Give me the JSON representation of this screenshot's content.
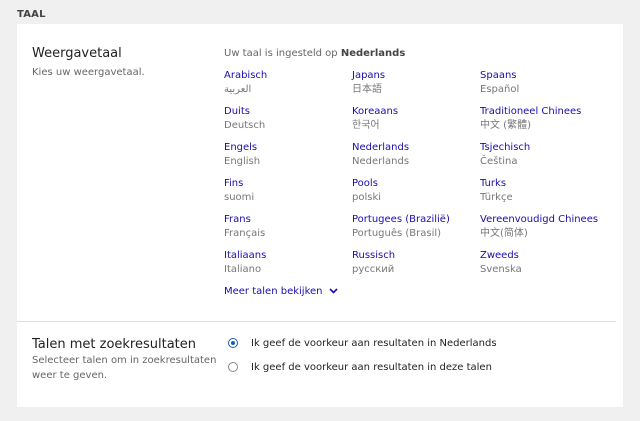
{
  "section_title": "TAAL",
  "display_language": {
    "heading": "Weergavetaal",
    "description": "Kies uw weergavetaal.",
    "current_prefix": "Uw taal is ingesteld op",
    "current_value": "Nederlands",
    "languages": [
      {
        "name": "Arabisch",
        "native": "العربية"
      },
      {
        "name": "Japans",
        "native": "日本語"
      },
      {
        "name": "Spaans",
        "native": "Español"
      },
      {
        "name": "Duits",
        "native": "Deutsch"
      },
      {
        "name": "Koreaans",
        "native": "한국어"
      },
      {
        "name": "Traditioneel Chinees",
        "native": "中文 (繁體)"
      },
      {
        "name": "Engels",
        "native": "English"
      },
      {
        "name": "Nederlands",
        "native": "Nederlands"
      },
      {
        "name": "Tsjechisch",
        "native": "Čeština"
      },
      {
        "name": "Fins",
        "native": "suomi"
      },
      {
        "name": "Pools",
        "native": "polski"
      },
      {
        "name": "Turks",
        "native": "Türkçe"
      },
      {
        "name": "Frans",
        "native": "Français"
      },
      {
        "name": "Portugees (Brazilië)",
        "native": "Português (Brasil)"
      },
      {
        "name": "Vereenvoudigd Chinees",
        "native": "中文(简体)"
      },
      {
        "name": "Italiaans",
        "native": "Italiano"
      },
      {
        "name": "Russisch",
        "native": "русский"
      },
      {
        "name": "Zweeds",
        "native": "Svenska"
      }
    ],
    "more_link": "Meer talen bekijken",
    "more_icon": "chevron-down-icon"
  },
  "search_results_languages": {
    "heading": "Talen met zoekresultaten",
    "description_line1": "Selecteer talen om in zoekresultaten",
    "description_line2": "weer te geven.",
    "options": [
      {
        "label": "Ik geef de voorkeur aan resultaten in Nederlands",
        "selected": true
      },
      {
        "label": "Ik geef de voorkeur aan resultaten in deze talen",
        "selected": false
      }
    ]
  },
  "colors": {
    "link": "#1a0dab",
    "accent": "#1a5fb4",
    "background": "#f0f0f0",
    "card": "#ffffff"
  }
}
